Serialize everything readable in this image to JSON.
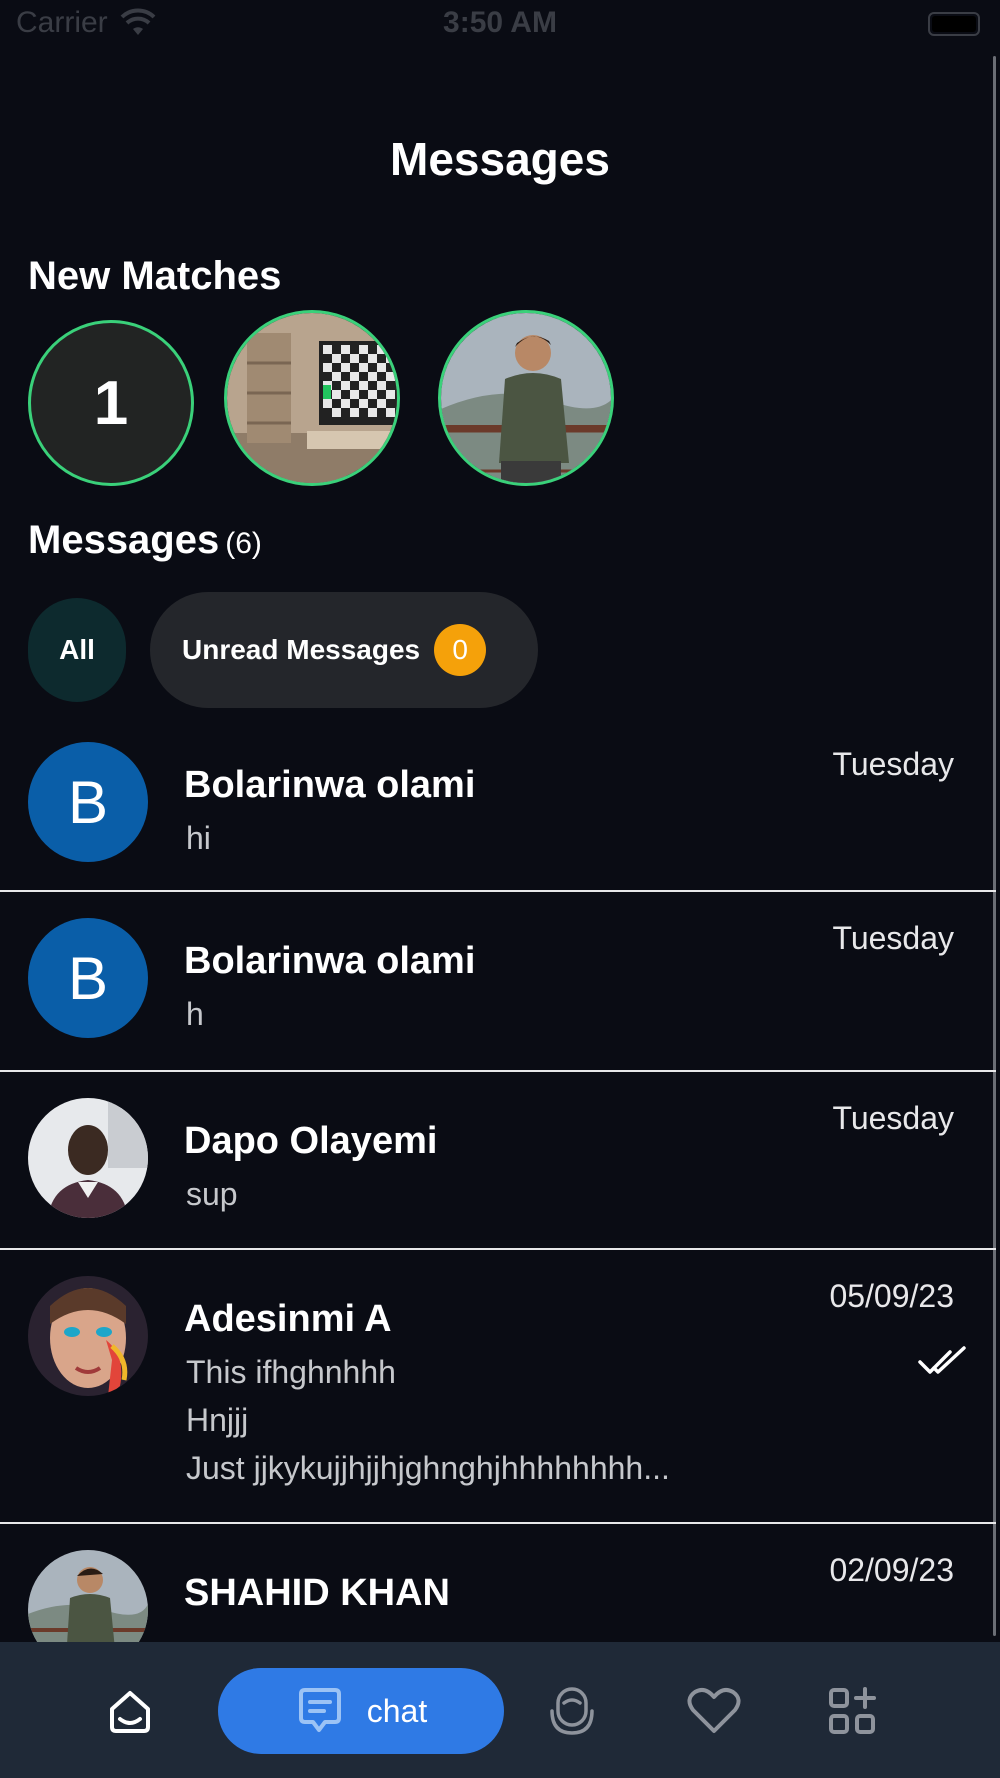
{
  "status_bar": {
    "carrier": "Carrier",
    "time": "3:50 AM"
  },
  "header": {
    "title": "Messages"
  },
  "new_matches": {
    "title": "New Matches",
    "count_badge": "1"
  },
  "messages_section": {
    "title": "Messages",
    "count": "(6)"
  },
  "filters": {
    "all_label": "All",
    "unread_label": "Unread Messages",
    "unread_count": "0"
  },
  "conversations": [
    {
      "avatar_letter": "B",
      "name": "Bolarinwa olami",
      "preview": "hi",
      "date": "Tuesday"
    },
    {
      "avatar_letter": "B",
      "name": "Bolarinwa olami",
      "preview": "h",
      "date": "Tuesday"
    },
    {
      "name": "Dapo Olayemi",
      "preview": "sup",
      "date": "Tuesday"
    },
    {
      "name": "Adesinmi A",
      "preview_lines": [
        "This ifhghnhhh",
        "Hnjjj",
        "Just jjkykujjhjjhjghnghjhhhhhhhh..."
      ],
      "date": "05/09/23",
      "read_receipt": "double-check-icon"
    },
    {
      "name": "SHAHID KHAN",
      "date": "02/09/23"
    }
  ],
  "tab_bar": {
    "chat_label": "chat"
  },
  "colors": {
    "background": "#0a0c14",
    "accent": "#2f7ae5",
    "match_ring": "#3ad17a",
    "badge": "#f5a10a",
    "avatar_blue": "#0a5ea8",
    "tab_bar": "#1f2937"
  }
}
